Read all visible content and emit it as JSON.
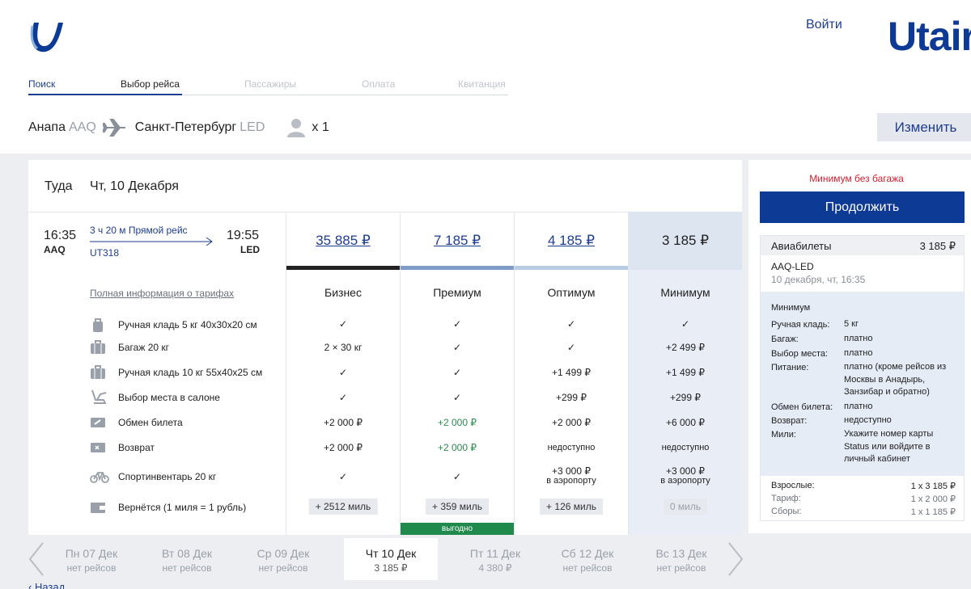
{
  "header": {
    "login": "Войти",
    "brand": "Utair",
    "change_button": "Изменить"
  },
  "steps": [
    {
      "label": "Поиск",
      "state": "done"
    },
    {
      "label": "Выбор рейса",
      "state": "active"
    },
    {
      "label": "Пассажиры",
      "state": "pending"
    },
    {
      "label": "Оплата",
      "state": "pending"
    },
    {
      "label": "Квитанция",
      "state": "pending"
    }
  ],
  "route": {
    "from_city": "Анапа",
    "from_code": "AAQ",
    "to_city": "Санкт-Петербург",
    "to_code": "LED",
    "passengers": "x 1"
  },
  "flight": {
    "direction": "Туда",
    "date": "Чт, 10 Декабря",
    "dep_time": "16:35",
    "dep_code": "AAQ",
    "arr_time": "19:55",
    "arr_code": "LED",
    "duration": "3 ч 20 м  Прямой рейс",
    "number": "UT318"
  },
  "fares_link": "Полная информация о тарифах",
  "features": [
    {
      "icon": "hand-bag-icon",
      "label": "Ручная кладь 5 кг 40x30x20 см"
    },
    {
      "icon": "luggage-icon",
      "label": "Багаж 20 кг"
    },
    {
      "icon": "suitcase-icon",
      "label": "Ручная кладь 10 кг 55x40x25 см"
    },
    {
      "icon": "seat-icon",
      "label": "Выбор места в салоне"
    },
    {
      "icon": "ticket-exchange-icon",
      "label": "Обмен билета"
    },
    {
      "icon": "ticket-refund-icon",
      "label": "Возврат"
    },
    {
      "icon": "bicycle-icon",
      "label": "Спортинвентарь 20 кг"
    },
    {
      "icon": "wallet-icon",
      "label": "Вернётся (1 миля = 1 рубль)"
    }
  ],
  "fares": [
    {
      "name": "Бизнес",
      "price": "35 885 ₽",
      "stripe": "#222222",
      "cells": [
        "✓",
        "2 × 30 кг",
        "✓",
        "✓",
        "+2 000 ₽",
        "+2 000 ₽",
        "✓"
      ],
      "sport_note": "",
      "miles": "+ 2512 миль",
      "deal": ""
    },
    {
      "name": "Премиум",
      "price": "7 185 ₽",
      "stripe": "#7e9cc6",
      "cells": [
        "✓",
        "✓",
        "✓",
        "✓",
        "+2 000 ₽",
        "+2 000 ₽",
        "✓"
      ],
      "sport_note": "",
      "miles": "+ 359 миль",
      "deal": "выгодно"
    },
    {
      "name": "Оптимум",
      "price": "4 185 ₽",
      "stripe": "#b8cce3",
      "cells": [
        "✓",
        "✓",
        "+1 499 ₽",
        "+299 ₽",
        "+2 000 ₽",
        "недоступно",
        "+3 000 ₽"
      ],
      "sport_note": "в аэропорту",
      "miles": "+ 126 миль",
      "deal": ""
    },
    {
      "name": "Минимум",
      "price": "3 185 ₽",
      "stripe": "",
      "cells": [
        "✓",
        "+2 499 ₽",
        "+1 499 ₽",
        "+299 ₽",
        "+6 000 ₽",
        "недоступно",
        "+3 000 ₽"
      ],
      "sport_note": "в аэропорту",
      "miles": "0 миль",
      "deal": ""
    }
  ],
  "dates": [
    {
      "day": "Пн 07 Дек",
      "info": "нет рейсов"
    },
    {
      "day": "Вт 08 Дек",
      "info": "нет рейсов"
    },
    {
      "day": "Ср 09 Дек",
      "info": "нет рейсов"
    },
    {
      "day": "Чт 10 Дек",
      "info": "3 185 ₽"
    },
    {
      "day": "Пт 11 Дек",
      "info": "4 380 ₽"
    },
    {
      "day": "Сб 12 Дек",
      "info": "нет рейсов"
    },
    {
      "day": "Вс 13 Дек",
      "info": "нет рейсов"
    }
  ],
  "back": "‹ Назад",
  "sidebar": {
    "note": "Минимум без багажа",
    "continue": "Продолжить",
    "tickets_label": "Авиабилеты",
    "tickets_price": "3 185 ₽",
    "route": "AAQ-LED",
    "date": "10 декабря, чт, 16:35",
    "fare": "Минимум",
    "details": [
      {
        "k": "Ручная кладь:",
        "v": "5 кг"
      },
      {
        "k": "Багаж:",
        "v": "платно"
      },
      {
        "k": "Выбор места:",
        "v": "платно"
      },
      {
        "k": "Питание:",
        "v": "платно (кроме рейсов из Москвы в Анадырь, Занзибар и обратно)"
      },
      {
        "k": "Обмен билета:",
        "v": "платно"
      },
      {
        "k": "Возврат:",
        "v": "недоступно"
      },
      {
        "k": "Мили:",
        "v": "Укажите номер карты Status или войдите в личный кабинет"
      }
    ],
    "totals": [
      {
        "k": "Взрослые:",
        "v": "1 x 3 185 ₽"
      },
      {
        "k": "Тариф:",
        "v": "1 x 2 000 ₽"
      },
      {
        "k": "Сборы:",
        "v": "1 x 1 185 ₽"
      }
    ]
  },
  "colors": {
    "accent": "#0d3a94",
    "link": "#1d3d8f",
    "deal": "#1f8a4c",
    "warning": "#d0202e"
  }
}
